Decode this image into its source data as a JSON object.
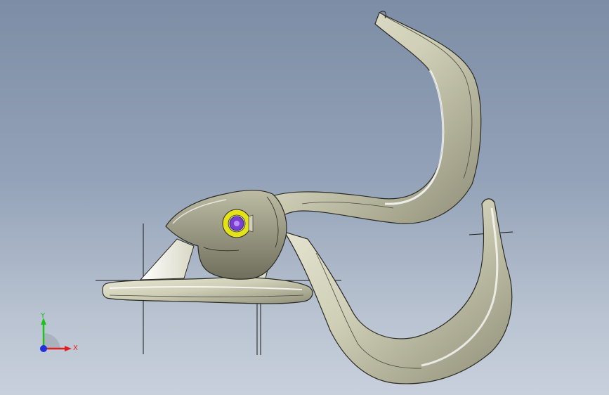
{
  "viewport": {
    "background_top": "#7d8da5",
    "background_bottom": "#c8d0dc"
  },
  "model": {
    "body_color": "#cfceb6",
    "edge_color": "#2a2a24",
    "pivot_outer_color": "#e6e21a",
    "pivot_inner_color": "#7a3fd0"
  },
  "triad": {
    "x_label": "X",
    "y_label": "Y",
    "x_color": "#e02020",
    "y_color": "#20c020",
    "z_color": "#2030e0"
  }
}
